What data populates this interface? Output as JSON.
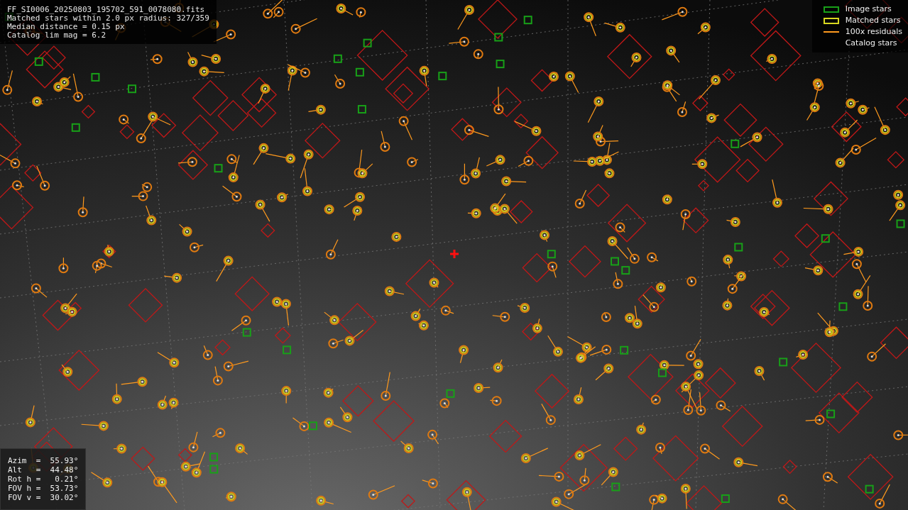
{
  "info_lines": [
    "FF_SI0006_20250803_195702_591_0078080.fits",
    "Matched stars within 2.0 px radius: 327/359",
    "Median distance = 0.15 px",
    "Catalog lim mag = 6.2"
  ],
  "legend": [
    {
      "label": "Image stars",
      "kind": "image"
    },
    {
      "label": "Matched stars",
      "kind": "matched"
    },
    {
      "label": "100x residuals",
      "kind": "residual"
    },
    {
      "label": "Catalog stars",
      "kind": "catalog"
    }
  ],
  "pointing": [
    "Azim  =  55.93°",
    "Alt   =  44.48°",
    "Rot h =   0.21°",
    "FOV h =  53.73°",
    "FOV v =  30.02°"
  ]
}
